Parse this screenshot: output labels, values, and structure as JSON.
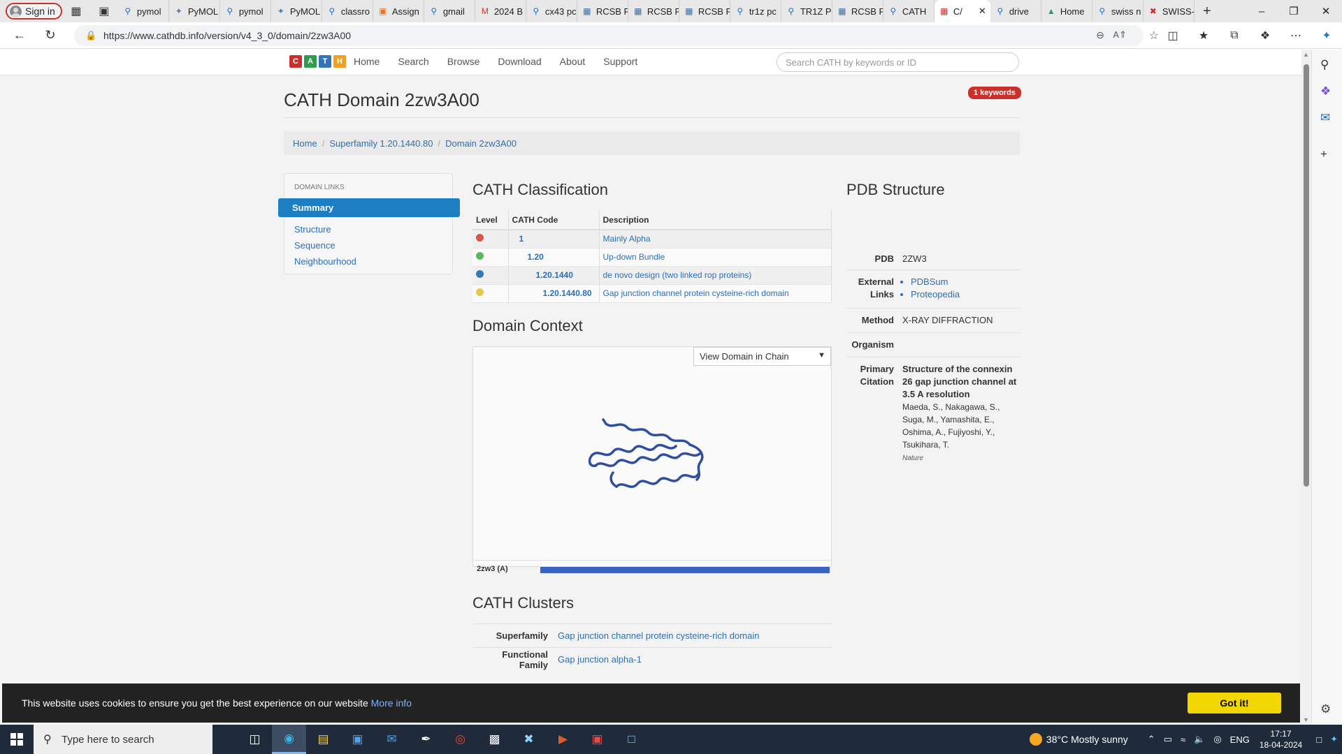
{
  "browser": {
    "signin_label": "Sign in",
    "tabs": [
      {
        "label": "pymol",
        "icon": "search-icon"
      },
      {
        "label": "PyMOL",
        "icon": "pymol-icon"
      },
      {
        "label": "pymol",
        "icon": "search-icon"
      },
      {
        "label": "PyMOL",
        "icon": "pymol-icon"
      },
      {
        "label": "classro",
        "icon": "search-icon"
      },
      {
        "label": "Assign",
        "icon": "assignment-icon"
      },
      {
        "label": "gmail",
        "icon": "search-icon"
      },
      {
        "label": "2024 B",
        "icon": "gmail-icon"
      },
      {
        "label": "cx43 pc",
        "icon": "search-icon"
      },
      {
        "label": "RCSB F",
        "icon": "rcsb-icon"
      },
      {
        "label": "RCSB F",
        "icon": "rcsb-icon"
      },
      {
        "label": "RCSB F",
        "icon": "rcsb-icon"
      },
      {
        "label": "tr1z pc",
        "icon": "search-icon"
      },
      {
        "label": "TR1Z P",
        "icon": "search-icon"
      },
      {
        "label": "RCSB F",
        "icon": "rcsb-icon"
      },
      {
        "label": "CATH",
        "icon": "search-icon"
      },
      {
        "label": "C/",
        "icon": "cath-icon"
      },
      {
        "label": "drive",
        "icon": "search-icon"
      },
      {
        "label": "Home",
        "icon": "drive-icon"
      },
      {
        "label": "swiss n",
        "icon": "search-icon"
      },
      {
        "label": "SWISS-",
        "icon": "swiss-icon"
      }
    ],
    "url": "https://www.cathdb.info/version/v4_3_0/domain/2zw3A00"
  },
  "site": {
    "logo_letters": [
      "C",
      "A",
      "T",
      "H"
    ],
    "logo_colors": [
      "#c9302c",
      "#2e9e4e",
      "#3274b8",
      "#f0a020"
    ],
    "nav": [
      "Home",
      "Search",
      "Browse",
      "Download",
      "About",
      "Support"
    ],
    "search_placeholder": "Search CATH by keywords or ID"
  },
  "page": {
    "title": "CATH Domain 2zw3A00",
    "keywords_badge": "1 keywords",
    "breadcrumb": [
      "Home",
      "Superfamily 1.20.1440.80",
      "Domain 2zw3A00"
    ]
  },
  "sidebar": {
    "heading": "DOMAIN LINKS",
    "active": "Summary",
    "links": [
      "Structure",
      "Sequence",
      "Neighbourhood"
    ]
  },
  "classification": {
    "heading": "CATH Classification",
    "columns": [
      "Level",
      "CATH Code",
      "Description"
    ],
    "rows": [
      {
        "dot_color": "#d9534f",
        "code": "1",
        "description": "Mainly Alpha"
      },
      {
        "dot_color": "#5cb85c",
        "code": "1.20",
        "description": "Up-down Bundle"
      },
      {
        "dot_color": "#337ab7",
        "code": "1.20.1440",
        "description": "de novo design (two linked rop proteins)"
      },
      {
        "dot_color": "#e6c84a",
        "code": "1.20.1440.80",
        "description": "Gap junction channel protein cysteine-rich domain"
      }
    ]
  },
  "context": {
    "heading": "Domain Context",
    "view_select": "View Domain in Chain",
    "chain_label": "2zw3 (A)",
    "chain_fill_fraction": 1.0,
    "chain_color": "#3a62c0"
  },
  "clusters": {
    "heading": "CATH Clusters",
    "rows": [
      {
        "label": "Superfamily",
        "value": "Gap junction channel protein cysteine-rich domain"
      },
      {
        "label": "Functional Family",
        "value": "Gap junction alpha-1"
      }
    ]
  },
  "pdb": {
    "heading": "PDB Structure",
    "pdb_label": "PDB",
    "pdb_value": "2ZW3",
    "links_label": "External Links",
    "links": [
      "PDBSum",
      "Proteopedia"
    ],
    "method_label": "Method",
    "method_value": "X-RAY DIFFRACTION",
    "organism_label": "Organism",
    "citation_label": "Primary Citation",
    "citation_title": "Structure of the connexin 26 gap junction channel at 3.5 A resolution",
    "citation_authors": "Maeda, S., Nakagawa, S., Suga, M., Yamashita, E., Oshima, A., Fujiyoshi, Y., Tsukihara, T.",
    "citation_journal": "Nature"
  },
  "cookie": {
    "message": "This website uses cookies to ensure you get the best experience on our website",
    "more_info": "More info",
    "button": "Got it!"
  },
  "taskbar": {
    "search_placeholder": "Type here to search",
    "weather": "38°C  Mostly sunny",
    "lang": "ENG",
    "time": "17:17",
    "date": "18-04-2024"
  }
}
